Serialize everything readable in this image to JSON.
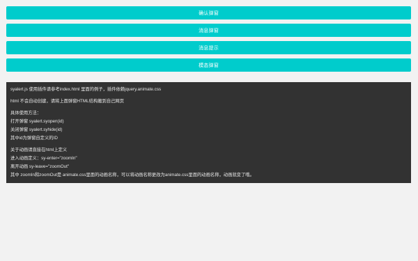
{
  "buttons": [
    {
      "label": "确认弹窗"
    },
    {
      "label": "消息弹窗"
    },
    {
      "label": "消息提示"
    },
    {
      "label": "模态弹窗"
    }
  ],
  "panel": {
    "lines": [
      "syalert.js 使用插件请参考index.html 里面的例子，插件依赖jquery.animate.css",
      "html 不会自动创建，请将上面弹窗HTML结构搬到自己网页",
      "具体使用方法：",
      "打开弹窗 syalert.syopen(id)",
      "关闭弹窗 syalert.syhide(id)",
      "其中id为弹窗自定义的ID",
      "关于动画请直接在html上定义",
      "进入动画定义：sy-enter=\"zoomIn\"",
      "离开动画 sy-leave=\"zoomOut\"",
      "其中 zoomIn和zoomOut是 animate.css里面的动画名称，可以将动画名称更改为animate.css里面的动画名称，动画就变了哦。"
    ]
  },
  "colors": {
    "accent": "#00cccc",
    "panel_bg": "#323232",
    "page_bg": "#f2f2f2"
  }
}
